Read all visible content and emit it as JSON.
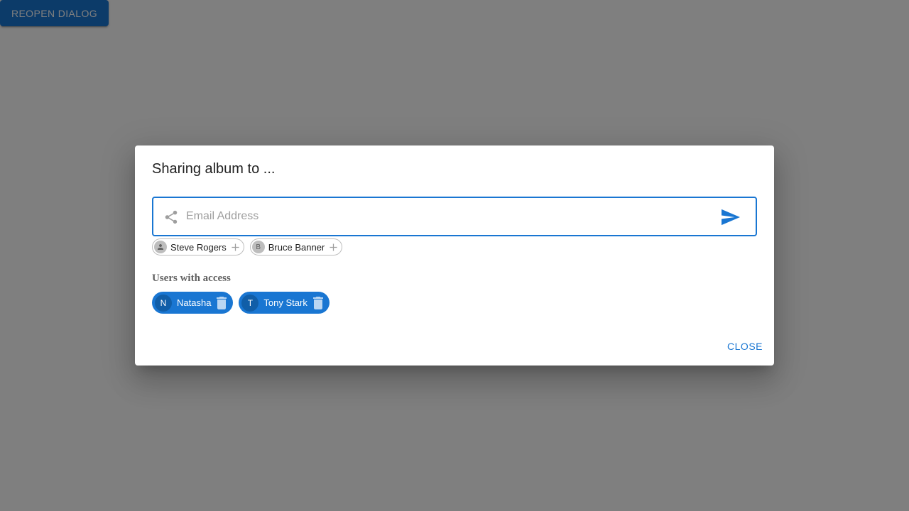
{
  "app": {
    "reopen_button_label": "Reopen Dialog"
  },
  "dialog": {
    "title": "Sharing album to ...",
    "email_field": {
      "placeholder": "Email Address",
      "value": ""
    },
    "suggestions": [
      {
        "name": "Steve Rogers",
        "avatar": "",
        "avatar_icon": "person-icon",
        "action_icon": "plus-icon"
      },
      {
        "name": "Bruce Banner",
        "avatar": "B",
        "action_icon": "plus-icon"
      }
    ],
    "access_heading": "Users with access",
    "users_with_access": [
      {
        "name": "Natasha",
        "avatar": "N",
        "action_icon": "trash-icon"
      },
      {
        "name": "Tony Stark",
        "avatar": "T",
        "action_icon": "trash-icon"
      }
    ],
    "close_button_label": "Close"
  },
  "colors": {
    "primary": "#1976d2",
    "primary_dark": "#115ea8",
    "backdrop": "rgba(0,0,0,0.5)",
    "chip_outline": "#bdbdbd",
    "muted_text": "#616161"
  },
  "icons": {
    "share": "share-icon",
    "send": "send-icon"
  }
}
